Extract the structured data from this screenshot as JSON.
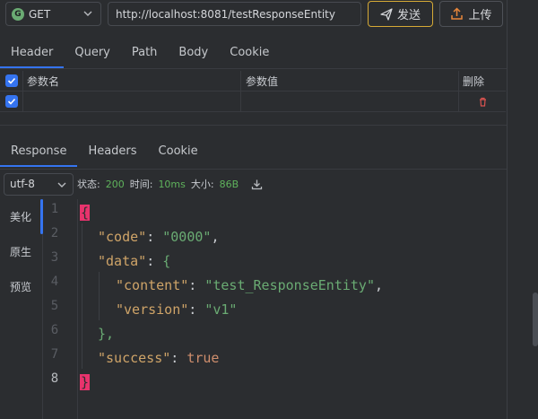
{
  "request": {
    "method": "GET",
    "method_badge": "G",
    "url": "http://localhost:8081/testResponseEntity",
    "send_label": "发送",
    "upload_label": "上传"
  },
  "request_tabs": [
    "Header",
    "Query",
    "Path",
    "Body",
    "Cookie"
  ],
  "request_active_tab": "Header",
  "param_table": {
    "headers": [
      "参数名",
      "参数值",
      "删除"
    ],
    "rows": [
      {
        "name": "",
        "value": ""
      }
    ]
  },
  "response_tabs": [
    "Response",
    "Headers",
    "Cookie"
  ],
  "response_active_tab": "Response",
  "status_bar": {
    "encoding": "utf-8",
    "status_label": "状态:",
    "status_value": "200",
    "time_label": "时间:",
    "time_value": "10ms",
    "size_label": "大小:",
    "size_value": "86B"
  },
  "side_nav": {
    "items": [
      "美化",
      "原生",
      "预览"
    ],
    "active": "美化"
  },
  "editor": {
    "line_numbers": [
      "1",
      "2",
      "3",
      "4",
      "5",
      "6",
      "7",
      "8"
    ],
    "lines": [
      {
        "t": "{"
      },
      {
        "k": "\"code\"",
        "colon": ": ",
        "s": "\"0000\"",
        "end": ","
      },
      {
        "k": "\"data\"",
        "colon": ": ",
        "p": "{"
      },
      {
        "k": "\"content\"",
        "colon": ": ",
        "s": "\"test_ResponseEntity\"",
        "end": ","
      },
      {
        "k": "\"version\"",
        "colon": ": ",
        "s": "\"v1\""
      },
      {
        "t": "},"
      },
      {
        "k": "\"success\"",
        "colon": ": ",
        "b": "true"
      },
      {
        "t": "}"
      }
    ]
  },
  "colors": {
    "accent": "#3574f0",
    "send_border": "#d6aa36",
    "status_green": "#5fb35c",
    "brace_highlight": "#e8336d",
    "json_key": "#cfa468",
    "json_string": "#6aab73",
    "json_bool": "#cf8e6d",
    "delete_red": "#d9534f"
  },
  "icons": {
    "method_chevron": "chevron-down-icon",
    "send": "paper-plane-icon",
    "upload": "upload-icon",
    "delete": "trash-icon",
    "download": "download-icon"
  }
}
